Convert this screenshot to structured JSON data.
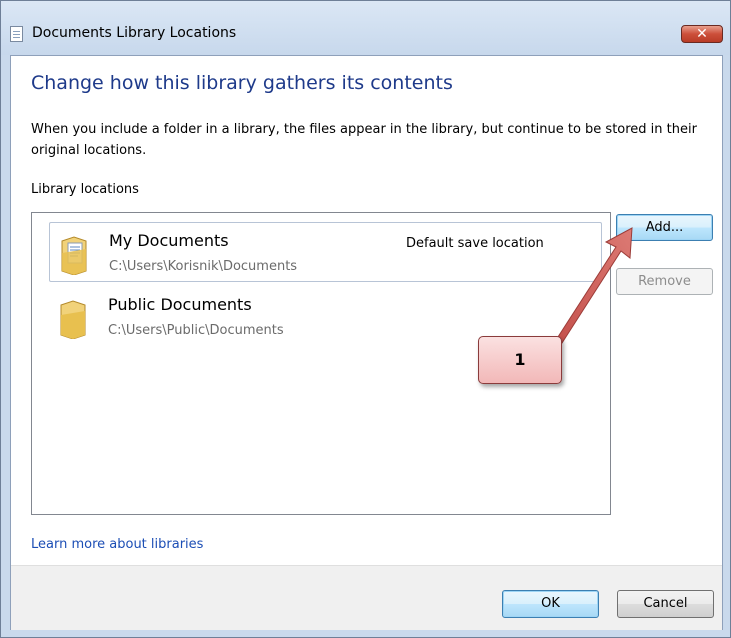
{
  "window": {
    "title": "Documents Library Locations",
    "close_label": "✕"
  },
  "heading": "Change how this library gathers its contents",
  "description": "When you include a folder in a library, the files appear in the library, but continue to be stored in their original locations.",
  "library_locations_label": "Library locations",
  "locations": [
    {
      "name": "My Documents",
      "path": "C:\\Users\\Korisnik\\Documents",
      "badge": "Default save location",
      "icon": "documents-folder-icon",
      "selected": true
    },
    {
      "name": "Public Documents",
      "path": "C:\\Users\\Public\\Documents",
      "badge": "",
      "icon": "folder-icon",
      "selected": false
    }
  ],
  "buttons": {
    "add": "Add...",
    "remove": "Remove",
    "ok": "OK",
    "cancel": "Cancel"
  },
  "learn_more_link": "Learn more about libraries",
  "annotation": {
    "callout_text": "1",
    "color": "#d0605a"
  },
  "colors": {
    "heading": "#1e3a8a",
    "link": "#1c4eb5",
    "close_button": "#cc4f3a"
  }
}
